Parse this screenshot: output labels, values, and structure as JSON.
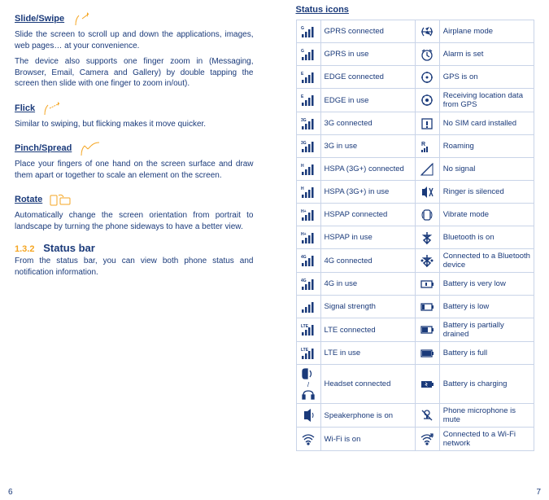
{
  "left": {
    "gestures": [
      {
        "title": "Slide/Swipe",
        "desc1": "Slide the screen to scroll up and down the applications, images, web pages… at your convenience.",
        "desc2": "The device also supports one finger zoom in (Messaging, Browser, Email, Camera and Gallery) by double tapping the screen then slide with one finger to zoom in/out)."
      },
      {
        "title": "Flick",
        "desc1": "Similar to swiping, but flicking makes it move quicker."
      },
      {
        "title": "Pinch/Spread",
        "desc1": "Place your fingers of one hand on the screen surface and draw them apart or together to scale an element on the screen."
      },
      {
        "title": "Rotate",
        "desc1": "Automatically change the screen orientation from portrait to landscape by turning the phone sideways to have a better view."
      }
    ],
    "section": {
      "num": "1.3.2",
      "title": "Status bar"
    },
    "section_desc": "From the status bar, you can view both phone status and notification information.",
    "page": "6"
  },
  "right": {
    "title": "Status icons",
    "rows": [
      [
        "GPRS connected",
        "Airplane mode"
      ],
      [
        "GPRS in use",
        "Alarm is set"
      ],
      [
        "EDGE connected",
        "GPS is on"
      ],
      [
        "EDGE in use",
        "Receiving location data from GPS"
      ],
      [
        "3G connected",
        "No SIM card installed"
      ],
      [
        "3G in use",
        "Roaming"
      ],
      [
        "HSPA (3G+) connected",
        "No signal"
      ],
      [
        "HSPA (3G+) in use",
        "Ringer is silenced"
      ],
      [
        "HSPAP connected",
        "Vibrate mode"
      ],
      [
        "HSPAP in use",
        "Bluetooth is on"
      ],
      [
        "4G connected",
        "Connected to a Bluetooth device"
      ],
      [
        "4G in use",
        "Battery is very low"
      ],
      [
        "Signal strength",
        "Battery is low"
      ],
      [
        "LTE connected",
        "Battery is partially drained"
      ],
      [
        "LTE in use",
        "Battery is full"
      ],
      [
        "Headset connected",
        "Battery is charging"
      ],
      [
        "Speakerphone is on",
        "Phone microphone is mute"
      ],
      [
        "Wi-Fi is on",
        "Connected to a Wi-Fi network"
      ]
    ],
    "page": "7"
  }
}
